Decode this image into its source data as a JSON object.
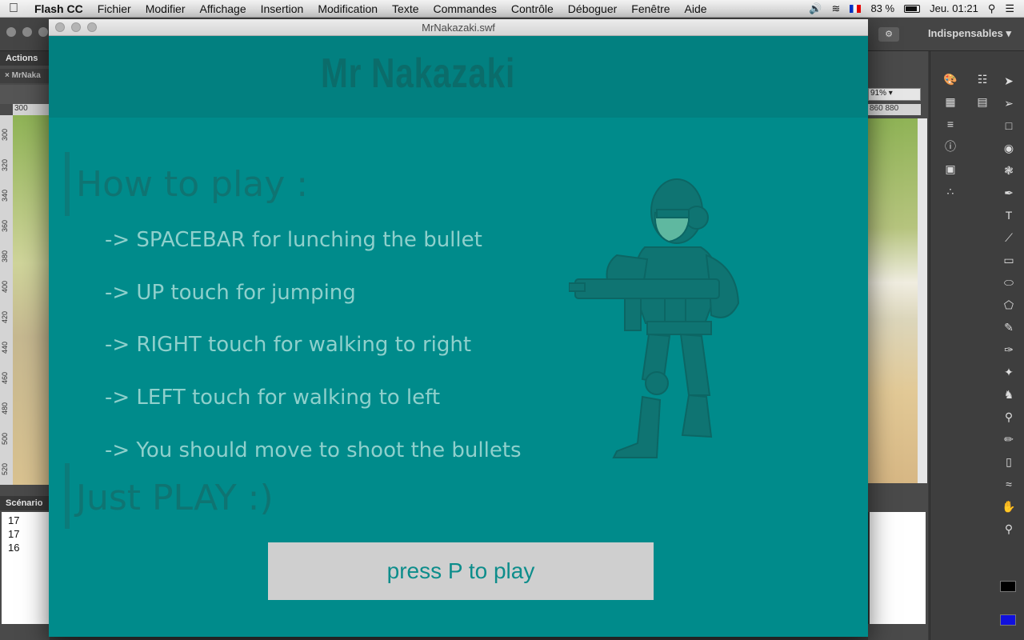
{
  "menubar": {
    "app_name": "Flash CC",
    "items": [
      "Fichier",
      "Modifier",
      "Affichage",
      "Insertion",
      "Modification",
      "Texte",
      "Commandes",
      "Contrôle",
      "Déboguer",
      "Fenêtre",
      "Aide"
    ],
    "battery": "83 %",
    "clock": "Jeu. 01:21"
  },
  "flash": {
    "workspace": "Indispensables",
    "actions_tab": "Actions",
    "doc_tab": "MrNaka",
    "ruler_top_left": "300",
    "ruler_left": [
      "300",
      "320",
      "340",
      "360",
      "380",
      "400",
      "420",
      "440",
      "460",
      "480",
      "500",
      "520"
    ],
    "zoom": "91%",
    "ruler_top_right": "860 880",
    "scenario_tab": "Scénario",
    "timeline_rows": [
      "17",
      "17",
      "16"
    ]
  },
  "swf": {
    "window_title": "MrNakazaki.swf",
    "game_title": "Mr Nakazaki",
    "howto_title": "How to play :",
    "rules": [
      "-> SPACEBAR for lunching the bullet",
      "-> UP touch for jumping",
      "-> RIGHT touch for walking to right",
      "-> LEFT touch for walking to left",
      "-> You should move to shoot the bullets"
    ],
    "just_play": "Just PLAY :)",
    "play_button": "press P to play"
  },
  "colors": {
    "game_bg": "#008b8b",
    "header_bg": "#028080",
    "title_text": "#0b6c6a",
    "rule_text": "#8fd0cc",
    "button_bg": "#cfcfcf",
    "button_text": "#0d8d8b",
    "fill_color": "#1010dd"
  }
}
